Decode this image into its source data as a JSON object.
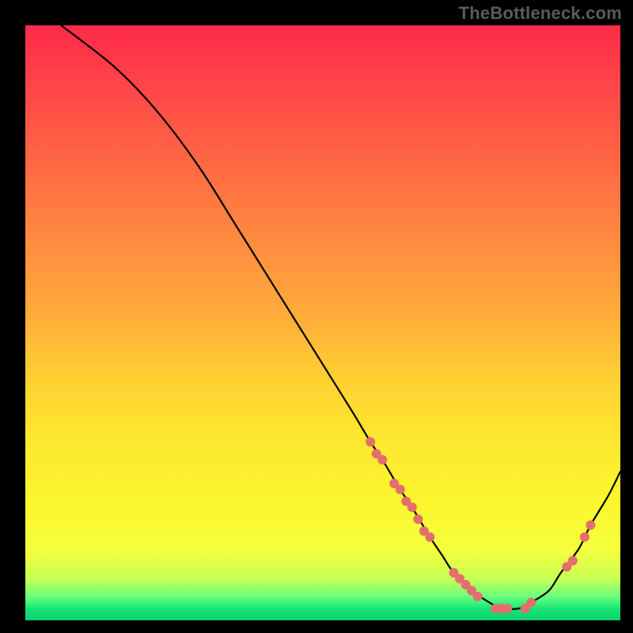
{
  "watermark": "TheBottleneck.com",
  "colors": {
    "background": "#000000",
    "curve": "#000000",
    "marker": "#e46e6e",
    "gradient_top": "#ff2a49",
    "gradient_bottom": "#0dcf6e"
  },
  "chart_data": {
    "type": "line",
    "title": "",
    "xlabel": "",
    "ylabel": "",
    "xlim": [
      0,
      100
    ],
    "ylim": [
      0,
      100
    ],
    "x": [
      6,
      10,
      15,
      20,
      25,
      30,
      35,
      40,
      45,
      50,
      55,
      58,
      60,
      63,
      65,
      68,
      70,
      72,
      75,
      78,
      80,
      83,
      85,
      88,
      90,
      93,
      95,
      98,
      100
    ],
    "values": [
      100,
      97,
      93,
      88,
      82,
      75,
      67,
      59,
      51,
      43,
      35,
      30,
      27,
      22,
      19,
      14,
      11,
      8,
      5,
      3,
      2,
      2,
      3,
      5,
      8,
      12,
      16,
      21,
      25
    ],
    "series": [
      {
        "name": "bottleneck-curve",
        "x": [
          6,
          10,
          15,
          20,
          25,
          30,
          35,
          40,
          45,
          50,
          55,
          58,
          60,
          63,
          65,
          68,
          70,
          72,
          75,
          78,
          80,
          83,
          85,
          88,
          90,
          93,
          95,
          98,
          100
        ],
        "values": [
          100,
          97,
          93,
          88,
          82,
          75,
          67,
          59,
          51,
          43,
          35,
          30,
          27,
          22,
          19,
          14,
          11,
          8,
          5,
          3,
          2,
          2,
          3,
          5,
          8,
          12,
          16,
          21,
          25
        ]
      }
    ],
    "markers": [
      {
        "x": 58,
        "y": 30
      },
      {
        "x": 59,
        "y": 28
      },
      {
        "x": 60,
        "y": 27
      },
      {
        "x": 62,
        "y": 23
      },
      {
        "x": 63,
        "y": 22
      },
      {
        "x": 64,
        "y": 20
      },
      {
        "x": 65,
        "y": 19
      },
      {
        "x": 66,
        "y": 17
      },
      {
        "x": 67,
        "y": 15
      },
      {
        "x": 68,
        "y": 14
      },
      {
        "x": 72,
        "y": 8
      },
      {
        "x": 73,
        "y": 7
      },
      {
        "x": 74,
        "y": 6
      },
      {
        "x": 75,
        "y": 5
      },
      {
        "x": 76,
        "y": 4
      },
      {
        "x": 79,
        "y": 2
      },
      {
        "x": 80,
        "y": 2
      },
      {
        "x": 81,
        "y": 2
      },
      {
        "x": 84,
        "y": 2
      },
      {
        "x": 85,
        "y": 3
      },
      {
        "x": 91,
        "y": 9
      },
      {
        "x": 92,
        "y": 10
      },
      {
        "x": 94,
        "y": 14
      },
      {
        "x": 95,
        "y": 16
      }
    ],
    "marker_radius": 6
  }
}
